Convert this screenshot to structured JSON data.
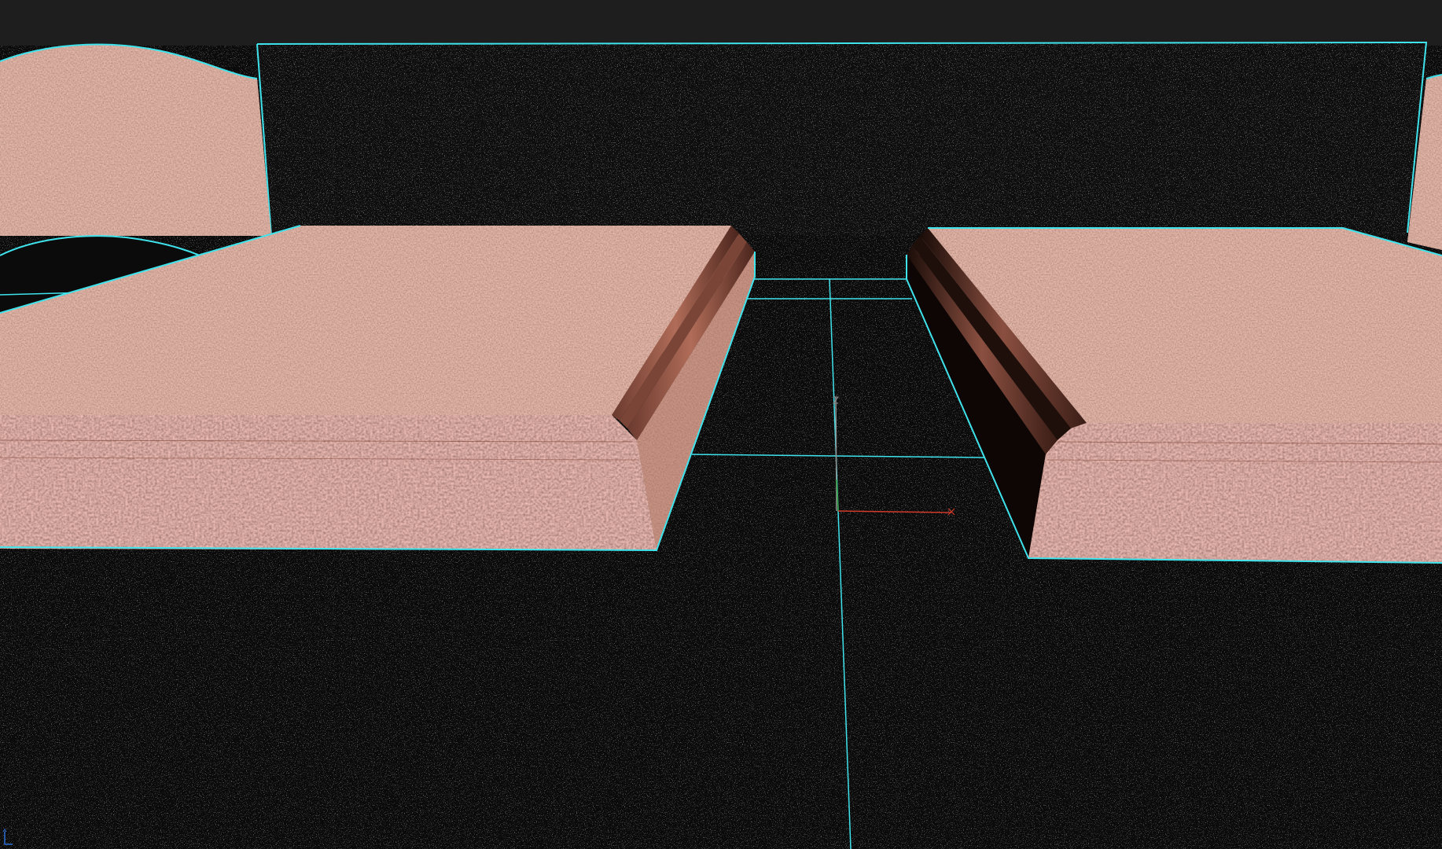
{
  "viewport": {
    "background": "#202020",
    "selection_color": "#3fe3ec",
    "axis_colors": {
      "x": "#d23a2a",
      "y": "#2e9f3a",
      "z": "#8f8f8f"
    },
    "materials": {
      "granite": "#c47e6c",
      "granite_dark": "#8e5447",
      "black_granite": "#0b0b0b"
    },
    "icons": {
      "transform_gizmo": "xyz-axis-gizmo-icon",
      "corner_orientation": "view-axis-tripod-icon"
    }
  }
}
